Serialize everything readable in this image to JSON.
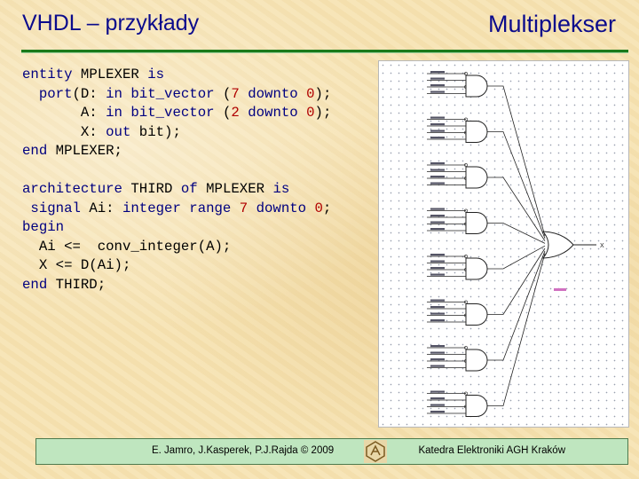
{
  "slide": {
    "title_left": "VHDL – przykłady",
    "title_right": "Multiplekser"
  },
  "code": {
    "entity": [
      [
        {
          "t": "entity ",
          "c": "kw"
        },
        {
          "t": "MPLEXER ",
          "c": ""
        },
        {
          "t": "is",
          "c": "kw"
        }
      ],
      [
        {
          "t": "  port",
          "c": "kw"
        },
        {
          "t": "(D: ",
          "c": ""
        },
        {
          "t": "in ",
          "c": "kw"
        },
        {
          "t": "bit_vector ",
          "c": "kw"
        },
        {
          "t": "(",
          "c": ""
        },
        {
          "t": "7 ",
          "c": "num"
        },
        {
          "t": "downto ",
          "c": "kw"
        },
        {
          "t": "0",
          "c": "num"
        },
        {
          "t": ");",
          "c": ""
        }
      ],
      [
        {
          "t": "       A: ",
          "c": ""
        },
        {
          "t": "in ",
          "c": "kw"
        },
        {
          "t": "bit_vector ",
          "c": "kw"
        },
        {
          "t": "(",
          "c": ""
        },
        {
          "t": "2 ",
          "c": "num"
        },
        {
          "t": "downto ",
          "c": "kw"
        },
        {
          "t": "0",
          "c": "num"
        },
        {
          "t": ");",
          "c": ""
        }
      ],
      [
        {
          "t": "       X: ",
          "c": ""
        },
        {
          "t": "out ",
          "c": "kw"
        },
        {
          "t": "bit);",
          "c": ""
        }
      ],
      [
        {
          "t": "end ",
          "c": "kw"
        },
        {
          "t": "MPLEXER;",
          "c": ""
        }
      ]
    ],
    "architecture": [
      [
        {
          "t": "architecture ",
          "c": "kw"
        },
        {
          "t": "THIRD ",
          "c": ""
        },
        {
          "t": "of ",
          "c": "kw"
        },
        {
          "t": "MPLEXER ",
          "c": ""
        },
        {
          "t": "is",
          "c": "kw"
        }
      ],
      [
        {
          "t": " signal ",
          "c": "kw"
        },
        {
          "t": "Ai: ",
          "c": ""
        },
        {
          "t": "integer ",
          "c": "kw"
        },
        {
          "t": "range ",
          "c": "kw"
        },
        {
          "t": "7 ",
          "c": "num"
        },
        {
          "t": "downto ",
          "c": "kw"
        },
        {
          "t": "0",
          "c": "num"
        },
        {
          "t": ";",
          "c": ""
        }
      ],
      [
        {
          "t": "begin",
          "c": "kw"
        }
      ],
      [
        {
          "t": "  Ai <=  conv_integer(A);",
          "c": ""
        }
      ],
      [
        {
          "t": "  X <= D(Ai);",
          "c": ""
        }
      ],
      [
        {
          "t": "end ",
          "c": "kw"
        },
        {
          "t": "THIRD;",
          "c": ""
        }
      ]
    ]
  },
  "schematic": {
    "gate_count": 8,
    "output_label": "X"
  },
  "footer": {
    "authors": "E. Jamro, J.Kasperek, P.J.Rajda © 2009",
    "institution": "Katedra Elektroniki AGH Kraków"
  },
  "colors": {
    "title": "#0b0b8c",
    "rule": "#1a7a1a",
    "keyword": "#000080",
    "number": "#b00000",
    "footer_bg": "#bfe6bf"
  }
}
